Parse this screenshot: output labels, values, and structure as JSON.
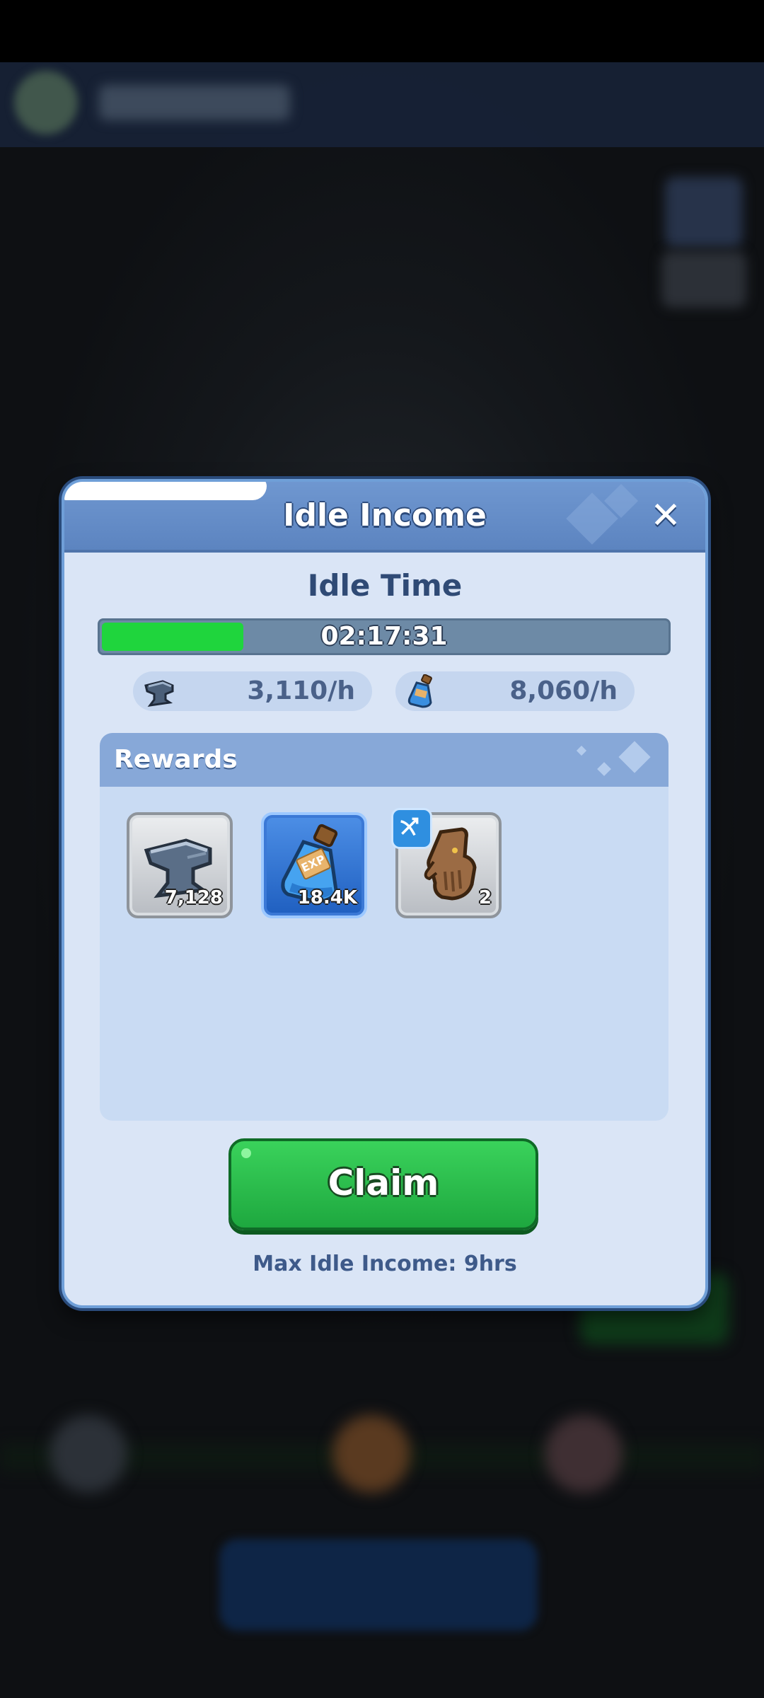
{
  "popup": {
    "title": "Idle Income",
    "idle_label": "Idle Time",
    "idle_timer": "02:17:31",
    "idle_progress": 0.25,
    "rates": [
      {
        "icon": "iron-anvil-icon",
        "value": "3,110/h"
      },
      {
        "icon": "exp-potion-icon",
        "value": "8,060/h"
      }
    ],
    "rewards_title": "Rewards",
    "rewards": [
      {
        "icon": "iron-anvil-icon",
        "count": "7,128",
        "frame": "gray"
      },
      {
        "icon": "exp-potion-icon",
        "count": "18.4K",
        "frame": "blue",
        "label": "EXP"
      },
      {
        "icon": "glove-icon",
        "count": "2",
        "frame": "gray",
        "badge": "archer-class-icon"
      }
    ],
    "claim_label": "Claim",
    "max_idle_text": "Max Idle Income: 9hrs"
  },
  "colors": {
    "header": "#5c84c0",
    "panel": "#dae5f6",
    "claim_green": "#2bbf4d",
    "progress_green": "#1fd53d"
  }
}
